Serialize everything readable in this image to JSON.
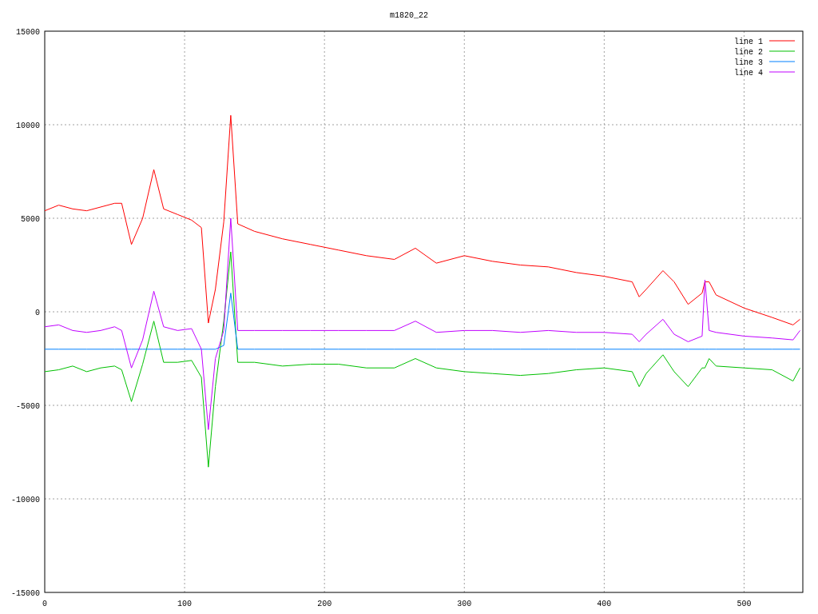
{
  "chart": {
    "chart_data": {
      "type": "line",
      "title": "m1820_22",
      "x": [
        0,
        10,
        20,
        30,
        40,
        50,
        55,
        62,
        70,
        78,
        85,
        95,
        105,
        112,
        117,
        122,
        128,
        133,
        138,
        150,
        170,
        190,
        210,
        230,
        250,
        265,
        280,
        300,
        320,
        340,
        360,
        380,
        400,
        420,
        425,
        430,
        442,
        450,
        460,
        470,
        472,
        475,
        480,
        500,
        520,
        535,
        540
      ],
      "series": [
        {
          "name": "line 1",
          "color": "#ff0000",
          "values": [
            5400,
            5700,
            5500,
            5400,
            5600,
            5800,
            5800,
            3600,
            5000,
            7600,
            5500,
            5200,
            4900,
            4500,
            -600,
            1200,
            4800,
            10500,
            4700,
            4300,
            3900,
            3600,
            3300,
            3000,
            2800,
            3400,
            2600,
            3000,
            2700,
            2500,
            2400,
            2100,
            1900,
            1600,
            800,
            1200,
            2200,
            1600,
            400,
            1000,
            1600,
            1600,
            900,
            200,
            -300,
            -700,
            -400
          ]
        },
        {
          "name": "line 2",
          "color": "#00c000",
          "values": [
            -3200,
            -3100,
            -2900,
            -3200,
            -3000,
            -2900,
            -3100,
            -4800,
            -2800,
            -500,
            -2700,
            -2700,
            -2600,
            -3500,
            -8300,
            -4000,
            -500,
            3200,
            -2700,
            -2700,
            -2900,
            -2800,
            -2800,
            -3000,
            -3000,
            -2500,
            -3000,
            -3200,
            -3300,
            -3400,
            -3300,
            -3100,
            -3000,
            -3200,
            -4000,
            -3300,
            -2300,
            -3200,
            -4000,
            -3000,
            -3000,
            -2500,
            -2900,
            -3000,
            -3100,
            -3700,
            -3000
          ]
        },
        {
          "name": "line 3",
          "color": "#0080ff",
          "values": [
            -2000,
            -2000,
            -2000,
            -2000,
            -2000,
            -2000,
            -2000,
            -2000,
            -2000,
            -2000,
            -2000,
            -2000,
            -2000,
            -2000,
            -2000,
            -2000,
            -1800,
            1000,
            -2000,
            -2000,
            -2000,
            -2000,
            -2000,
            -2000,
            -2000,
            -2000,
            -2000,
            -2000,
            -2000,
            -2000,
            -2000,
            -2000,
            -2000,
            -2000,
            -2000,
            -2000,
            -2000,
            -2000,
            -2000,
            -2000,
            -2000,
            -2000,
            -2000,
            -2000,
            -2000,
            -2000,
            -2000
          ]
        },
        {
          "name": "line 4",
          "color": "#c000ff",
          "values": [
            -800,
            -700,
            -1000,
            -1100,
            -1000,
            -800,
            -1000,
            -3000,
            -1500,
            1100,
            -800,
            -1000,
            -900,
            -2000,
            -6300,
            -2500,
            -1000,
            5000,
            -1000,
            -1000,
            -1000,
            -1000,
            -1000,
            -1000,
            -1000,
            -500,
            -1100,
            -1000,
            -1000,
            -1100,
            -1000,
            -1100,
            -1100,
            -1200,
            -1600,
            -1200,
            -400,
            -1200,
            -1600,
            -1300,
            1700,
            -1000,
            -1100,
            -1300,
            -1400,
            -1500,
            -1000
          ]
        }
      ],
      "grid": true,
      "legend": true,
      "xlim": [
        0,
        542
      ],
      "ylim": [
        -15000,
        15000
      ],
      "xticks": [
        0,
        100,
        200,
        300,
        400,
        500
      ],
      "yticks": [
        -15000,
        -10000,
        -5000,
        0,
        5000,
        10000,
        15000
      ]
    }
  }
}
